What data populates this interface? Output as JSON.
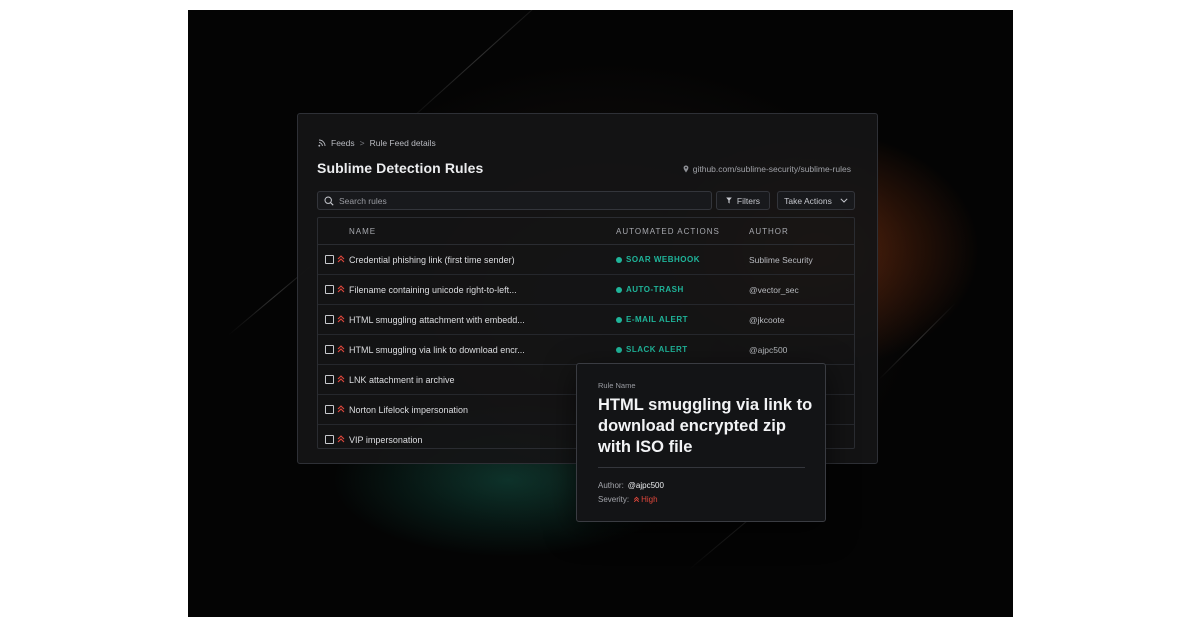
{
  "breadcrumb": {
    "feeds": "Feeds",
    "separator": ">",
    "current": "Rule Feed details"
  },
  "page_title": "Sublime Detection Rules",
  "repo_link": "github.com/sublime-security/sublime-rules",
  "search": {
    "placeholder": "Search rules"
  },
  "toolbar": {
    "filters_label": "Filters",
    "take_actions_label": "Take Actions"
  },
  "table": {
    "columns": {
      "name": "NAME",
      "actions": "AUTOMATED ACTIONS",
      "author": "AUTHOR"
    },
    "rows": [
      {
        "name": "Credential phishing link (first time sender)",
        "action": "SOAR WEBHOOK",
        "author": "Sublime Security"
      },
      {
        "name": "Filename containing unicode right-to-left...",
        "action": "AUTO-TRASH",
        "author": "@vector_sec"
      },
      {
        "name": "HTML smuggling attachment with embedd...",
        "action": "E-MAIL ALERT",
        "author": "@jkcoote"
      },
      {
        "name": "HTML smuggling via link to download encr...",
        "action": "SLACK ALERT",
        "author": "@ajpc500"
      },
      {
        "name": "LNK attachment in archive"
      },
      {
        "name": "Norton Lifelock impersonation"
      },
      {
        "name": "VIP impersonation"
      }
    ]
  },
  "detail_card": {
    "label": "Rule Name",
    "title": "HTML smuggling via link to download encrypted zip with ISO file",
    "author_label": "Author:",
    "author": "@ajpc500",
    "severity_label": "Severity:",
    "severity": "High"
  },
  "colors": {
    "background": "#040404",
    "action_accent": "#1fb59a",
    "severity_high": "#e0473c"
  },
  "icons": {
    "feeds": "rss-icon",
    "repo": "location-pin-icon",
    "search": "search-icon",
    "filters": "filter-icon",
    "take_actions": "chevron-down-icon",
    "severity": "double-chevron-up-icon"
  }
}
